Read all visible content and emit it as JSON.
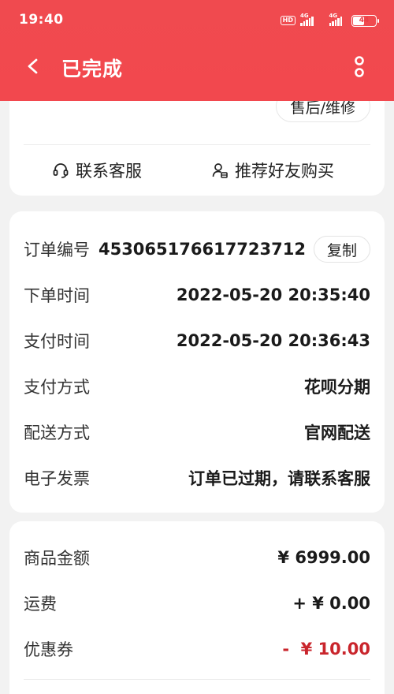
{
  "status_bar": {
    "time": "19:40",
    "hd_label": "HD",
    "network_1": "4G",
    "network_2": "4G",
    "battery": "44"
  },
  "nav": {
    "title": "已完成",
    "back_icon": "chevron-left-icon",
    "more_icon": "more-vertical-icon"
  },
  "card_actions": {
    "after_sale_label": "售后/维修",
    "contact_service_label": "联系客服",
    "recommend_label": "推荐好友购买"
  },
  "order_info": {
    "order_no_label": "订单编号",
    "order_no": "453065176617723712",
    "copy_label": "复制",
    "order_time_label": "下单时间",
    "order_time": "2022-05-20 20:35:40",
    "pay_time_label": "支付时间",
    "pay_time": "2022-05-20 20:36:43",
    "pay_method_label": "支付方式",
    "pay_method": "花呗分期",
    "delivery_label": "配送方式",
    "delivery": "官网配送",
    "invoice_label": "电子发票",
    "invoice": "订单已过期，请联系客服"
  },
  "price_info": {
    "goods_amount_label": "商品金额",
    "goods_amount": "¥ 6999.00",
    "shipping_label": "运费",
    "shipping": "+ ¥ 0.00",
    "coupon_label": "优惠券",
    "coupon": "-  ¥ 10.00"
  },
  "colors": {
    "header_red": "#f2484e",
    "discount_red": "#c9252c"
  }
}
